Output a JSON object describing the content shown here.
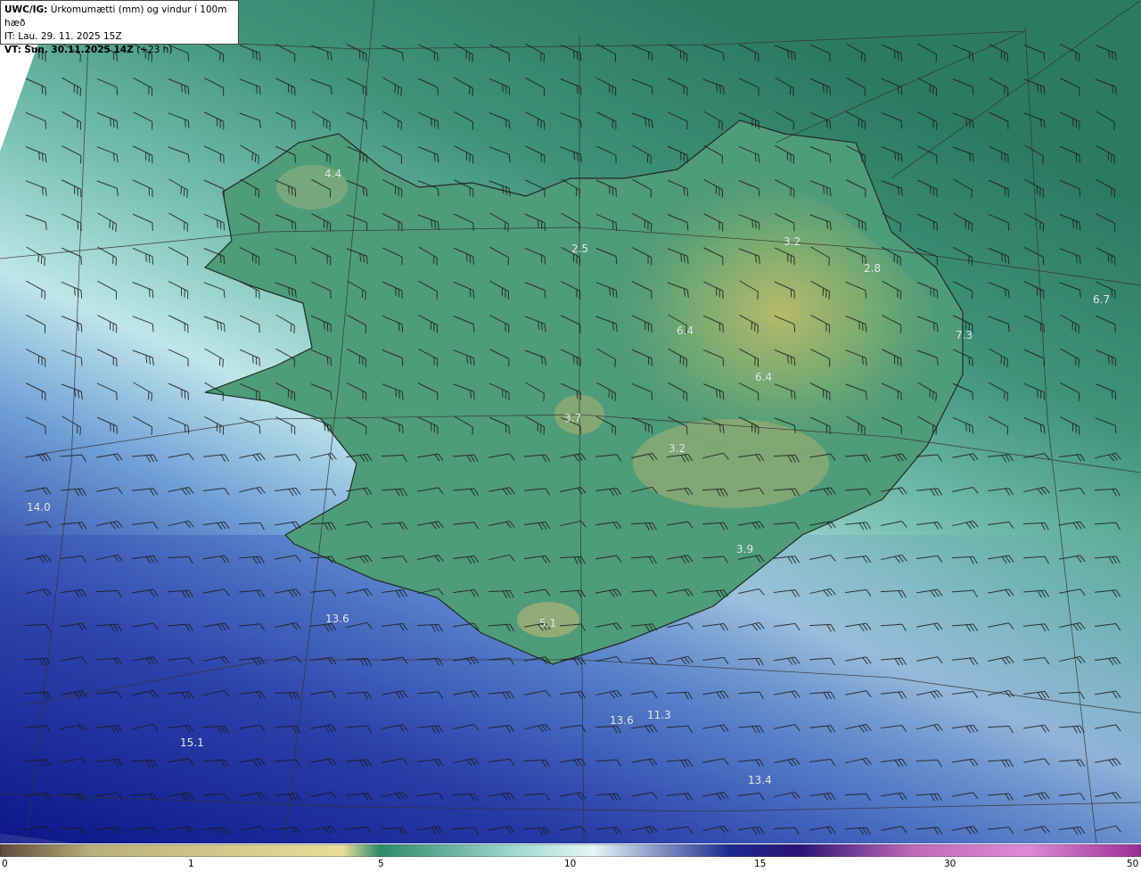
{
  "header": {
    "model": "UWC/IG:",
    "description": "Úrkomumætti (mm) og vindur í 100m hæð",
    "init_time": "IT: Lau. 29. 11. 2025 15Z",
    "valid_prefix": "VT:",
    "valid_time": "Sun. 30.11.2025 14Z",
    "lead_time": "(+23 h)"
  },
  "values": [
    {
      "id": "v1",
      "text": "4.4"
    },
    {
      "id": "v2",
      "text": "2.5"
    },
    {
      "id": "v3",
      "text": "3.2"
    },
    {
      "id": "v4",
      "text": "2.8"
    },
    {
      "id": "v5",
      "text": "6.7"
    },
    {
      "id": "v6",
      "text": "7.3"
    },
    {
      "id": "v7",
      "text": "6.4"
    },
    {
      "id": "v8",
      "text": "6.4"
    },
    {
      "id": "v9",
      "text": "3.7"
    },
    {
      "id": "v10",
      "text": "3.2"
    },
    {
      "id": "v11",
      "text": "14.0"
    },
    {
      "id": "v12",
      "text": "3.9"
    },
    {
      "id": "v13",
      "text": "5.1"
    },
    {
      "id": "v14",
      "text": "13.6"
    },
    {
      "id": "v15",
      "text": "13.6"
    },
    {
      "id": "v16",
      "text": "11.3"
    },
    {
      "id": "v17",
      "text": "15.1"
    },
    {
      "id": "v18",
      "text": "13.4"
    }
  ],
  "colorbar": {
    "ticks": [
      "0",
      "1",
      "5",
      "10",
      "15",
      "30",
      "50"
    ],
    "colors": [
      "#5e4a3a",
      "#b9b07a",
      "#e9df9a",
      "#2d8a6a",
      "#9fd9cf",
      "#e6f7f6",
      "#1c2a8f",
      "#2b1375",
      "#c06ab8",
      "#e08ad6",
      "#9a2f96"
    ]
  }
}
